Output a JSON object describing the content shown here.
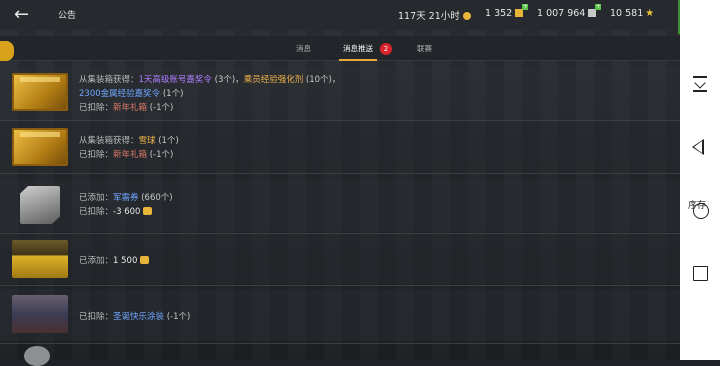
{
  "header": {
    "title": "公告",
    "timer": "117天 21小时",
    "gold_count": "1 352",
    "silver_count": "1 007 964",
    "free_xp": "10 581",
    "back_icon": "arrow-left-icon",
    "cart_icon": "cart-icon"
  },
  "tabs": [
    {
      "label": "消息"
    },
    {
      "label": "消息推送",
      "active": true,
      "badge": "2"
    },
    {
      "label": "联赛"
    }
  ],
  "rows": [
    {
      "thumb": "crate",
      "line1": {
        "prefix": "从集装箱获得：",
        "item1": "1天高级账号嘉奖令",
        "q1": " (3个)，",
        "item2": "乘员经验强化剂",
        "q2": " (10个)，"
      },
      "line2": {
        "item": "2300金属经验嘉奖令",
        "q": " (1个)"
      },
      "line3": {
        "prefix": "已扣除：",
        "item": "新年礼箱",
        "q": " (-1个)"
      }
    },
    {
      "thumb": "crate",
      "line1": {
        "prefix": "从集装箱获得：",
        "item": "雪球",
        "q": " (1个)"
      },
      "line2": {
        "prefix": "已扣除：",
        "item": "新年礼箱",
        "q": " (-1个)"
      }
    },
    {
      "thumb": "ticket",
      "line1": {
        "prefix": "已添加：",
        "item": "军需券",
        "q": " (660个)"
      },
      "line2": {
        "prefix": "已扣除：",
        "value": "-3 600"
      }
    },
    {
      "thumb": "chest",
      "line1": {
        "prefix": "已添加：",
        "value": "1 500"
      }
    },
    {
      "thumb": "paint",
      "line1": {
        "prefix": "已扣除：",
        "item": "圣诞快乐涂装",
        "q": " (-1个)"
      }
    }
  ],
  "navbar": {
    "label": "序存",
    "icons": [
      "download-icon",
      "back-triangle-icon",
      "home-circle-icon",
      "recent-square-icon"
    ]
  },
  "colors": {
    "accent": "#e8a83a",
    "badge": "#d8232a",
    "cart": "#3f8f36"
  }
}
